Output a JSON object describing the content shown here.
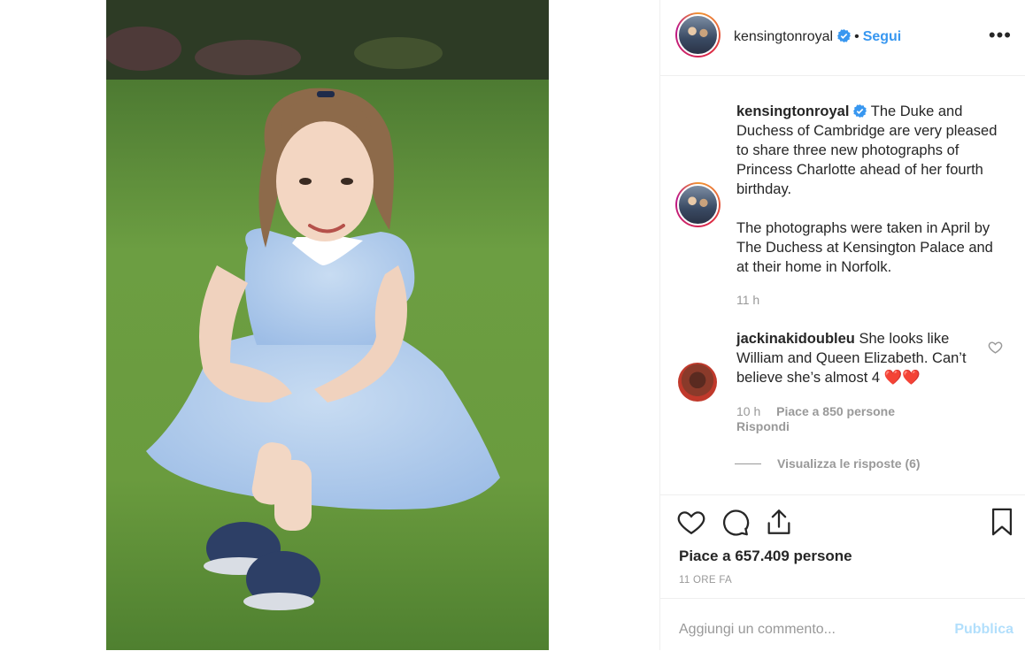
{
  "post": {
    "image_alt": "Princess Charlotte sitting on the grass in a floral dress"
  },
  "header": {
    "username": "kensingtonroyal",
    "separator": "•",
    "follow_label": "Segui",
    "more_label": "•••"
  },
  "caption": {
    "username": "kensingtonroyal",
    "paragraph1": "The Duke and Duchess of Cambridge are very pleased to share three new photographs of Princess Charlotte ahead of her fourth birthday.",
    "paragraph2": "The photographs were taken in April by The Duchess at Kensington Palace and at their home in Norfolk.",
    "time": "11 h"
  },
  "comment": {
    "username": "jackinakidoubleu",
    "text": "She looks like William and Queen Elizabeth. Can’t believe she’s almost 4",
    "emoji": "❤️❤️",
    "time": "10 h",
    "likes": "Piace a 850 persone",
    "reply_label": "Rispondi",
    "view_replies": "Visualizza le risposte (6)"
  },
  "actions": {
    "likes_text": "Piace a 657.409 persone",
    "time_ago": "11 ORE FA"
  },
  "add_comment": {
    "placeholder": "Aggiungi un commento...",
    "publish_label": "Pubblica"
  },
  "colors": {
    "link_blue": "#3897f0",
    "publish_disabled": "#b2dffc",
    "verified_blue": "#3897f0",
    "heart_red": "#ed4956"
  }
}
